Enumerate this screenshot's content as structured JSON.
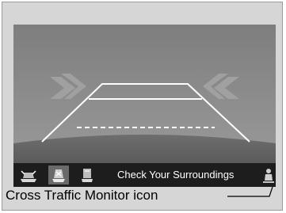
{
  "camera_view": {
    "status_message": "Check Your Surroundings",
    "view_modes": [
      {
        "icon": "wide-view-icon",
        "selected": false
      },
      {
        "icon": "normal-view-icon",
        "selected": true
      },
      {
        "icon": "top-down-view-icon",
        "selected": false
      }
    ],
    "cross_traffic_icon": "cross-traffic-monitor-icon"
  },
  "callout": {
    "label": "Cross Traffic Monitor icon"
  },
  "colors": {
    "frame_bg": "#d6d6d6",
    "sky": "#8c8c8c",
    "ground": "#5a5a5a",
    "guide_lines": "#ffffff",
    "chevrons": "#9a9a9a"
  }
}
